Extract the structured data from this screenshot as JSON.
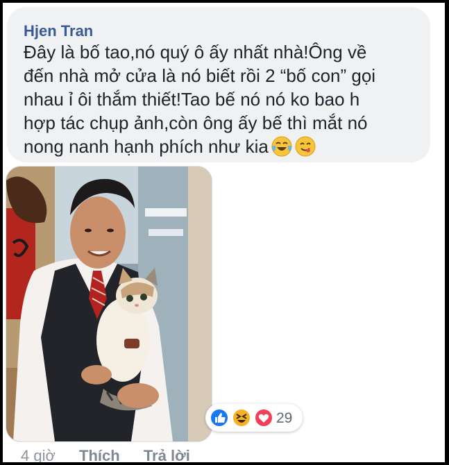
{
  "comment": {
    "author": "Hjen Tran",
    "lines": [
      "Đây là bố tao,nó quý ô ấy nhất nhà!Ông về",
      "đến nhà mở cửa là nó biết rồi 2 “bố con” gọi",
      "nhau ỉ ôi thắm thiết!Tao bế nó nó ko bao h",
      "hợp tác chụp ảnh,còn ông ấy bế thì mắt nó",
      "nong nanh hạnh phích như kia"
    ],
    "emojis": [
      "laughing-tears-emoji",
      "yum-emoji"
    ]
  },
  "reactions": {
    "icons": [
      "like-icon",
      "haha-icon",
      "love-icon"
    ],
    "count": "29"
  },
  "actions": {
    "time": "4 giờ",
    "like_label": "Thích",
    "reply_label": "Trả lời"
  },
  "colors": {
    "author": "#385898",
    "bubble": "#f0f1f3",
    "like": "#1877f2",
    "love": "#f33e58",
    "haha": "#f7b125"
  }
}
